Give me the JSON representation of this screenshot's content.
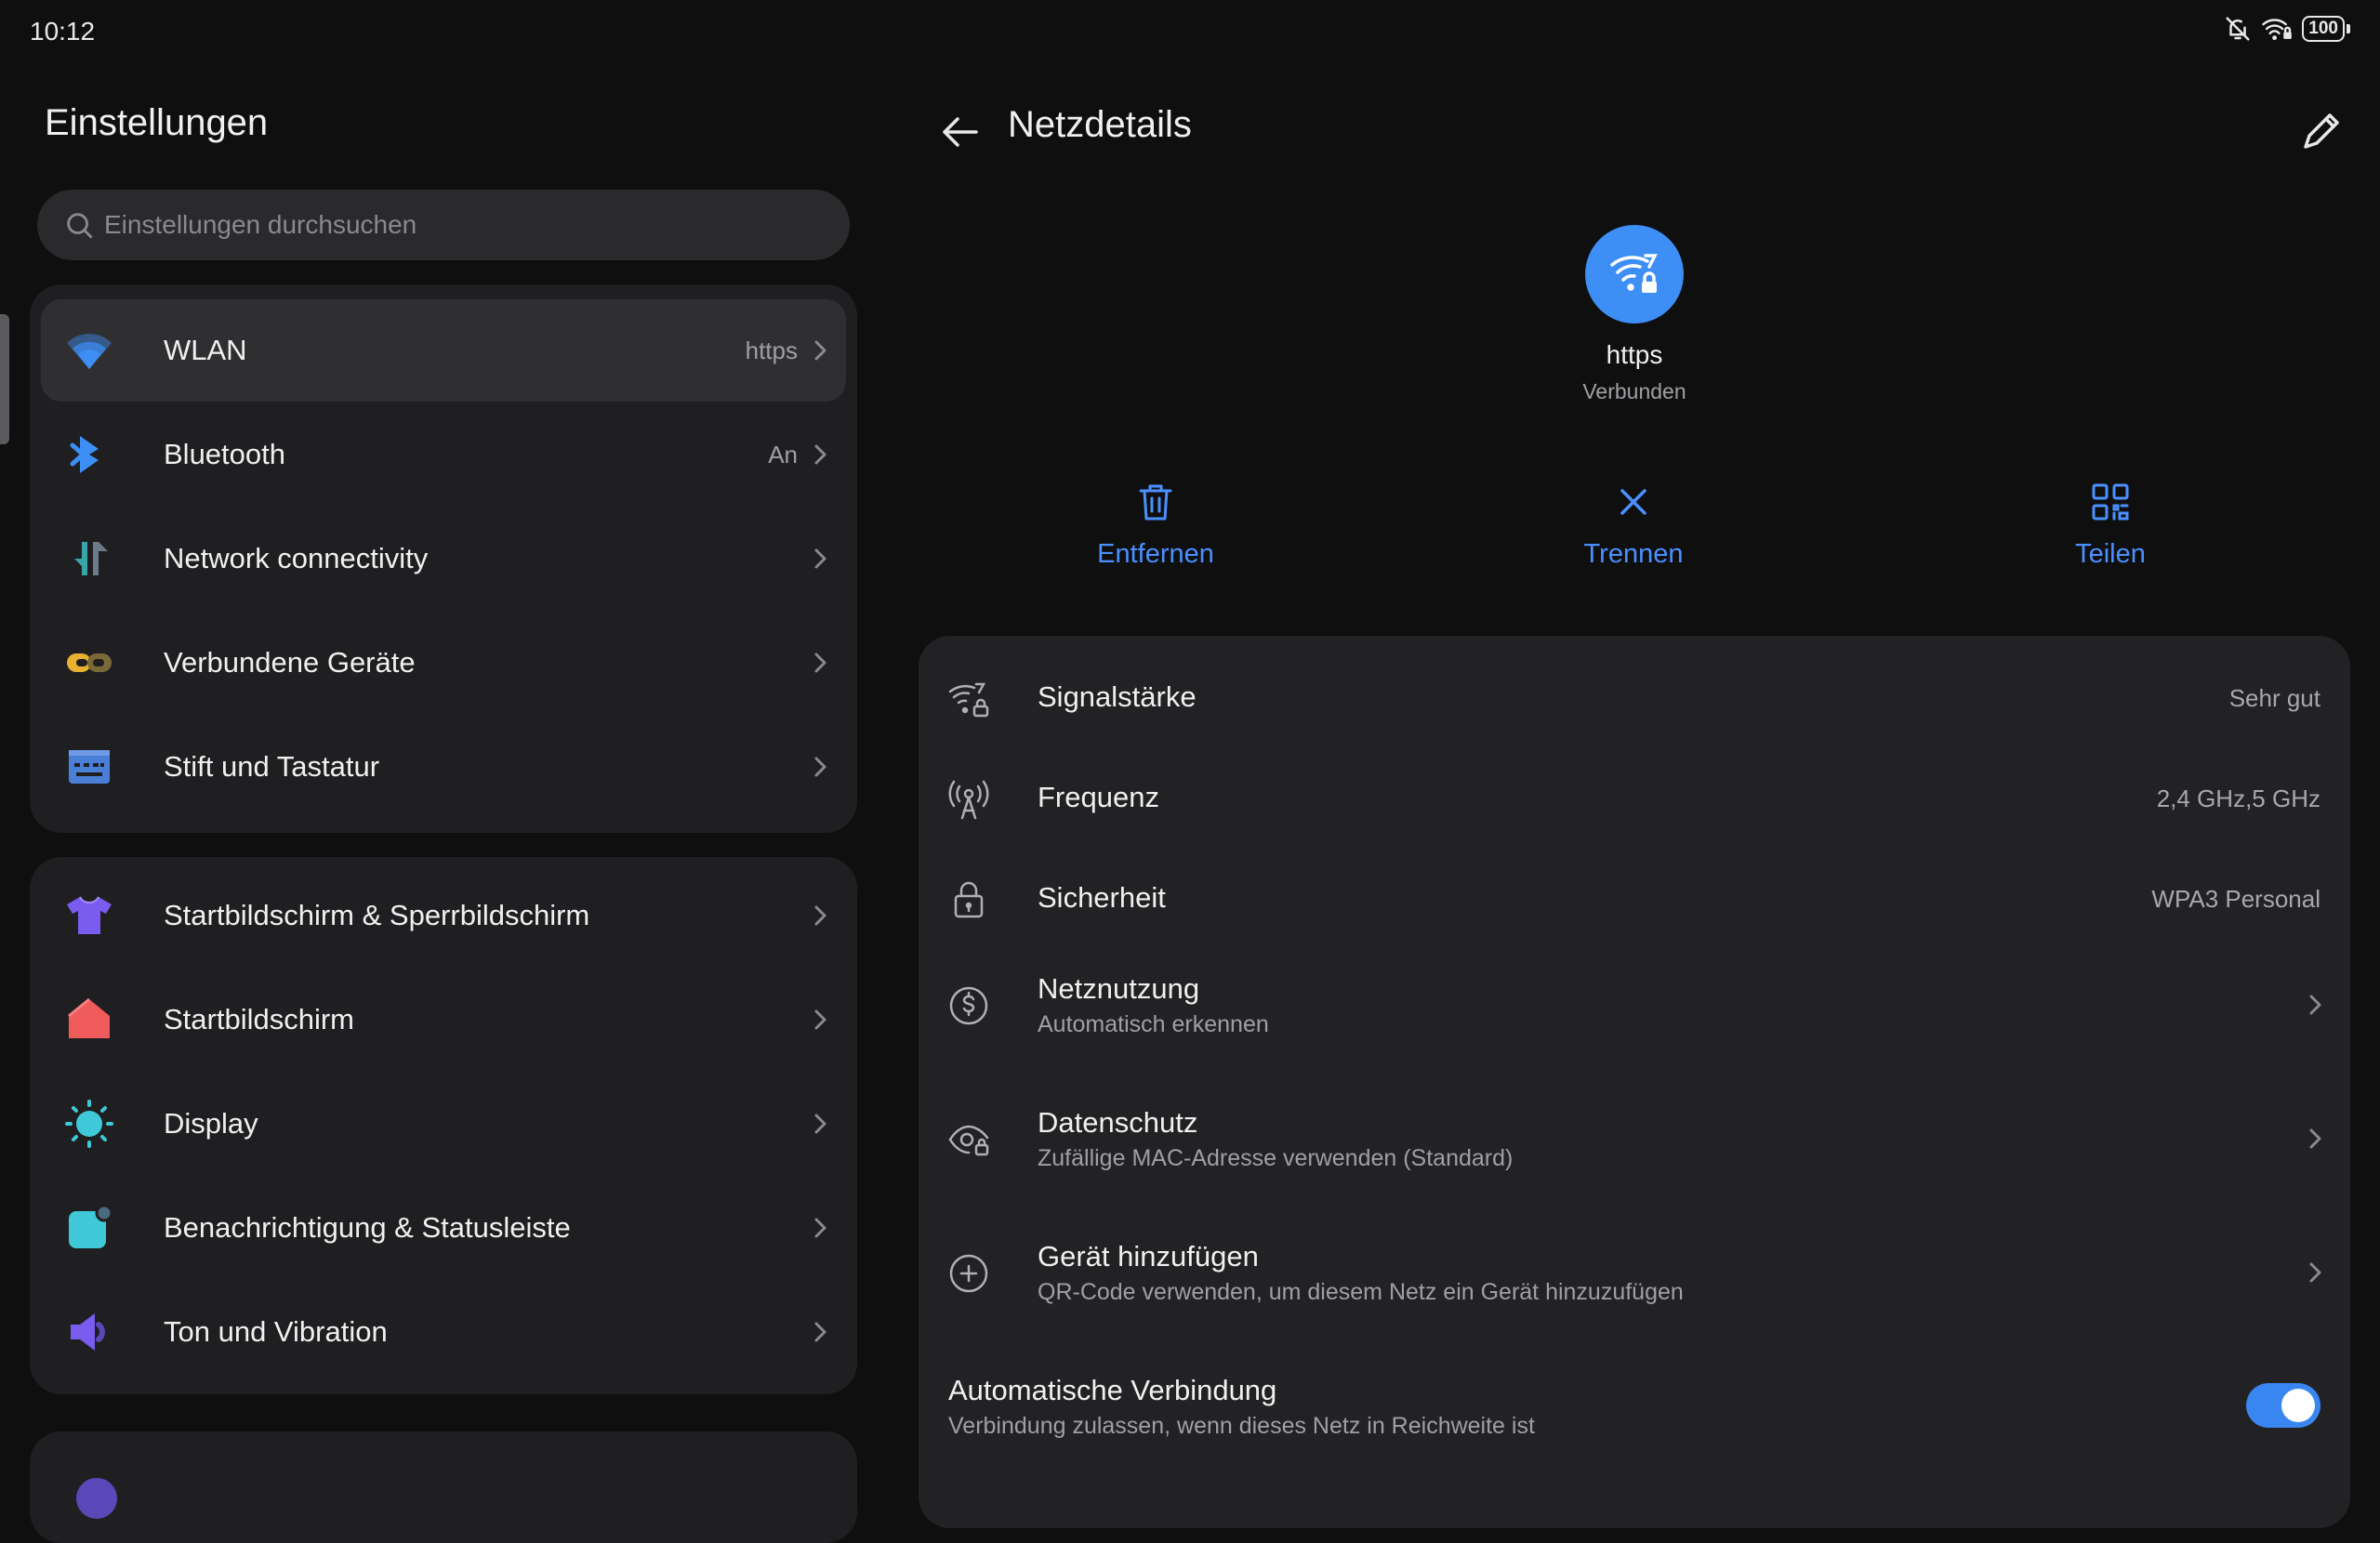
{
  "status_bar": {
    "time": "10:12",
    "battery": "100",
    "icons": [
      "bell-off-icon",
      "wifi-lock-icon",
      "battery-icon"
    ]
  },
  "left_pane": {
    "title": "Einstellungen",
    "search_placeholder": "Einstellungen durchsuchen",
    "groups": [
      {
        "items": [
          {
            "label": "WLAN",
            "value": "https",
            "icon": "wifi-icon",
            "selected": true
          },
          {
            "label": "Bluetooth",
            "value": "An",
            "icon": "bluetooth-icon"
          },
          {
            "label": "Network connectivity",
            "value": "",
            "icon": "network-connectivity-icon"
          },
          {
            "label": "Verbundene Geräte",
            "value": "",
            "icon": "connected-devices-icon"
          },
          {
            "label": "Stift und Tastatur",
            "value": "",
            "icon": "keyboard-icon"
          }
        ]
      },
      {
        "items": [
          {
            "label": "Startbildschirm & Sperrbildschirm",
            "value": "",
            "icon": "theme-shirt-icon"
          },
          {
            "label": "Startbildschirm",
            "value": "",
            "icon": "home-icon"
          },
          {
            "label": "Display",
            "value": "",
            "icon": "display-brightness-icon"
          },
          {
            "label": "Benachrichtigung & Statusleiste",
            "value": "",
            "icon": "notification-icon"
          },
          {
            "label": "Ton und Vibration",
            "value": "",
            "icon": "sound-icon"
          }
        ]
      }
    ],
    "colors": {
      "wifi": "#3d8ef5",
      "bluetooth": "#3d8ef5",
      "connectivity": "#3aa5a8",
      "devices": "#e8b230",
      "keyboard": "#4a7fd8",
      "theme": "#7a5cf0",
      "home": "#ef5a5a",
      "display": "#3fc9d8",
      "notification": "#3fc9d8",
      "sound": "#7a5cf0"
    }
  },
  "right_pane": {
    "title": "Netzdetails",
    "network": {
      "name": "https",
      "status": "Verbunden"
    },
    "actions": [
      {
        "label": "Entfernen",
        "icon": "trash-icon"
      },
      {
        "label": "Trennen",
        "icon": "close-icon"
      },
      {
        "label": "Teilen",
        "icon": "qr-code-icon"
      }
    ],
    "rows": [
      {
        "title": "Signalstärke",
        "value": "Sehr gut",
        "icon": "signal-icon"
      },
      {
        "title": "Frequenz",
        "value": "2,4 GHz,5 GHz",
        "icon": "antenna-icon"
      },
      {
        "title": "Sicherheit",
        "value": "WPA3 Personal",
        "icon": "lock-icon"
      },
      {
        "title": "Netznutzung",
        "subtitle": "Automatisch erkennen",
        "icon": "dollar-icon"
      },
      {
        "title": "Datenschutz",
        "subtitle": "Zufällige MAC-Adresse verwenden (Standard)",
        "icon": "privacy-eye-icon"
      },
      {
        "title": "Gerät hinzufügen",
        "subtitle": "QR-Code verwenden, um diesem Netz ein Gerät hinzuzufügen",
        "icon": "add-circle-icon"
      }
    ],
    "auto_connect": {
      "title": "Automatische Verbindung",
      "subtitle": "Verbindung zulassen, wenn dieses Netz in Reichweite ist",
      "enabled": true
    },
    "accent": "#4a90ff"
  }
}
